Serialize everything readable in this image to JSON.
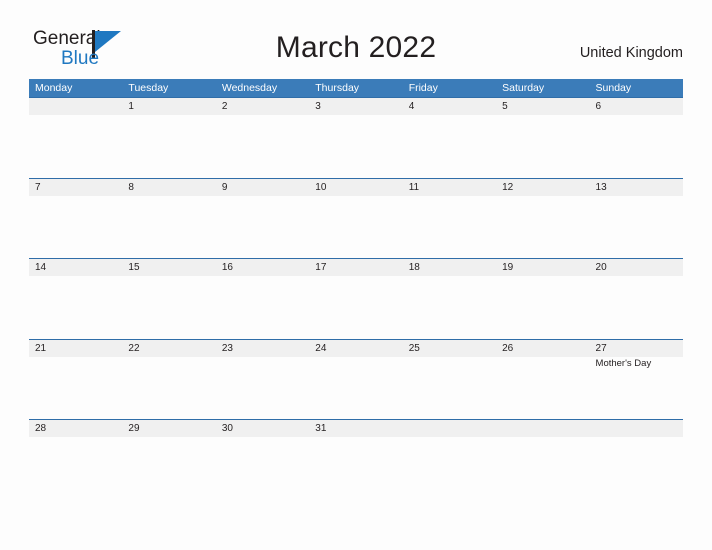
{
  "logo": {
    "word_top": "General",
    "word_bottom": "Blue",
    "flag_icon": "flag-icon",
    "accent_color": "#1f78c1"
  },
  "header": {
    "title": "March 2022",
    "country": "United Kingdom"
  },
  "calendar": {
    "header_bg_color": "#3b7cb9",
    "row_border_color": "#2f6da8",
    "date_band_color": "#f0f0f0",
    "weekdays": [
      "Monday",
      "Tuesday",
      "Wednesday",
      "Thursday",
      "Friday",
      "Saturday",
      "Sunday"
    ],
    "weeks": [
      {
        "days": [
          {
            "date": "",
            "event": ""
          },
          {
            "date": "1",
            "event": ""
          },
          {
            "date": "2",
            "event": ""
          },
          {
            "date": "3",
            "event": ""
          },
          {
            "date": "4",
            "event": ""
          },
          {
            "date": "5",
            "event": ""
          },
          {
            "date": "6",
            "event": ""
          }
        ]
      },
      {
        "days": [
          {
            "date": "7",
            "event": ""
          },
          {
            "date": "8",
            "event": ""
          },
          {
            "date": "9",
            "event": ""
          },
          {
            "date": "10",
            "event": ""
          },
          {
            "date": "11",
            "event": ""
          },
          {
            "date": "12",
            "event": ""
          },
          {
            "date": "13",
            "event": ""
          }
        ]
      },
      {
        "days": [
          {
            "date": "14",
            "event": ""
          },
          {
            "date": "15",
            "event": ""
          },
          {
            "date": "16",
            "event": ""
          },
          {
            "date": "17",
            "event": ""
          },
          {
            "date": "18",
            "event": ""
          },
          {
            "date": "19",
            "event": ""
          },
          {
            "date": "20",
            "event": ""
          }
        ]
      },
      {
        "days": [
          {
            "date": "21",
            "event": ""
          },
          {
            "date": "22",
            "event": ""
          },
          {
            "date": "23",
            "event": ""
          },
          {
            "date": "24",
            "event": ""
          },
          {
            "date": "25",
            "event": ""
          },
          {
            "date": "26",
            "event": ""
          },
          {
            "date": "27",
            "event": "Mother's Day"
          }
        ]
      },
      {
        "days": [
          {
            "date": "28",
            "event": ""
          },
          {
            "date": "29",
            "event": ""
          },
          {
            "date": "30",
            "event": ""
          },
          {
            "date": "31",
            "event": ""
          },
          {
            "date": "",
            "event": ""
          },
          {
            "date": "",
            "event": ""
          },
          {
            "date": "",
            "event": ""
          }
        ]
      }
    ]
  }
}
